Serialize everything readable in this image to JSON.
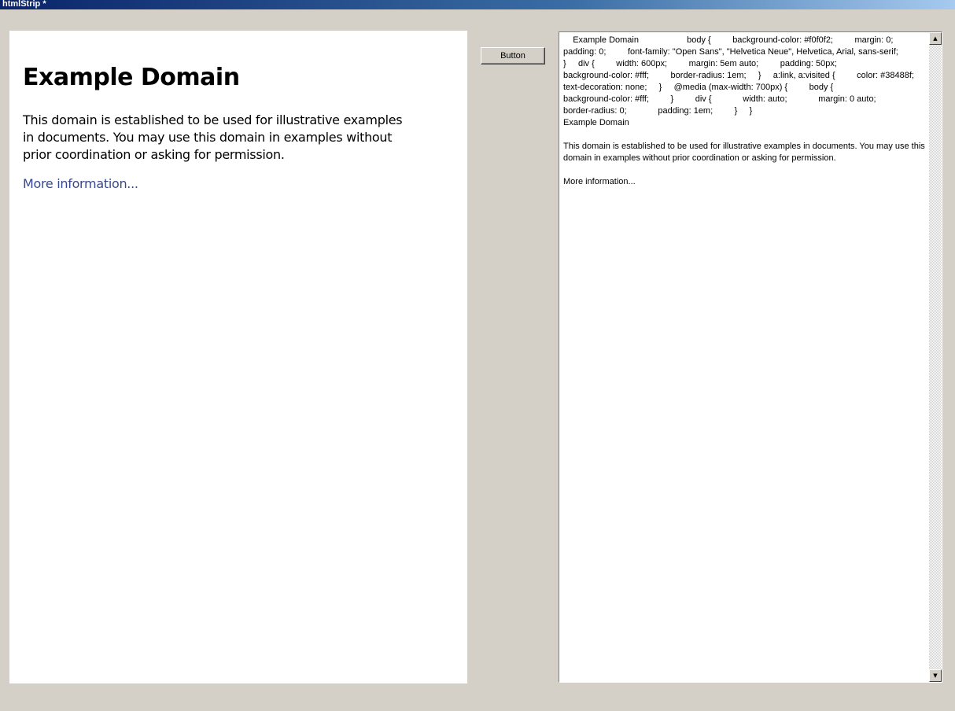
{
  "window": {
    "title": "htmlStrip *"
  },
  "browser": {
    "heading": "Example Domain",
    "paragraph": "This domain is established to be used for illustrative examples in documents. You may use this domain in examples without prior coordination or asking for permission.",
    "link": "More information..."
  },
  "button": {
    "label": "Button"
  },
  "textbox": {
    "lines": [
      "    Example Domain                    body {         background-color: #f0f0f2;         margin: 0;",
      "padding: 0;         font-family: \"Open Sans\", \"Helvetica Neue\", Helvetica, Arial, sans-serif;",
      "}     div {         width: 600px;         margin: 5em auto;         padding: 50px;",
      "background-color: #fff;         border-radius: 1em;     }     a:link, a:visited {         color: #38488f;",
      "text-decoration: none;     }     @media (max-width: 700px) {         body {",
      "background-color: #fff;         }         div {             width: auto;             margin: 0 auto;",
      "border-radius: 0;             padding: 1em;         }     }",
      "Example Domain",
      "",
      "This domain is established to be used for illustrative examples in documents. You may use this",
      "domain in examples without prior coordination or asking for permission.",
      "",
      "More information..."
    ]
  },
  "icons": {
    "scroll_up": "▲",
    "scroll_down": "▼"
  }
}
